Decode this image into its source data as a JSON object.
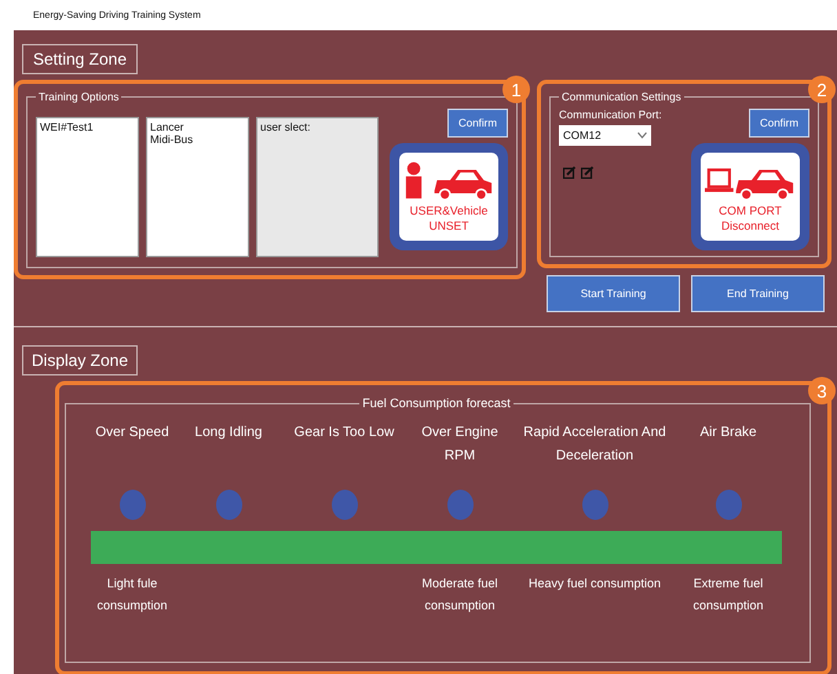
{
  "window": {
    "title": "Energy-Saving Driving Training System"
  },
  "setting_zone": {
    "title": "Setting Zone",
    "training_options": {
      "number": "1",
      "legend": "Training Options",
      "lists": [
        {
          "lines": [
            "WEI#Test1"
          ],
          "disabled": false
        },
        {
          "lines": [
            "Lancer",
            "Midi-Bus"
          ],
          "disabled": false
        },
        {
          "lines": [
            "user slect:"
          ],
          "disabled": true
        }
      ],
      "confirm": "Confirm",
      "status": {
        "kind": "user-vehicle",
        "label": "USER&Vehicle",
        "state": "UNSET"
      }
    },
    "communication_settings": {
      "number": "2",
      "legend": "Communication Settings",
      "port_label": "Communication Port:",
      "port": "COM12",
      "confirm": "Confirm",
      "status": {
        "kind": "com-port",
        "label": "COM PORT",
        "state": "Disconnect"
      }
    },
    "buttons": [
      "Start Training",
      "End Training"
    ]
  },
  "display_zone": {
    "title": "Display Zone",
    "number": "3",
    "legend": "Fuel Consumption forecast",
    "events": [
      {
        "label": "Over Speed",
        "consumption": "Light fule consumption"
      },
      {
        "label": "Long Idling"
      },
      {
        "label": "Gear Is Too Low"
      },
      {
        "label": "Over Engine RPM",
        "consumption": "Moderate fuel consumption"
      },
      {
        "label": "Rapid Acceleration And Deceleration",
        "consumption": "Heavy fuel consumption"
      },
      {
        "label": "Air Brake",
        "consumption": "Extreme fuel consumption"
      }
    ]
  }
}
